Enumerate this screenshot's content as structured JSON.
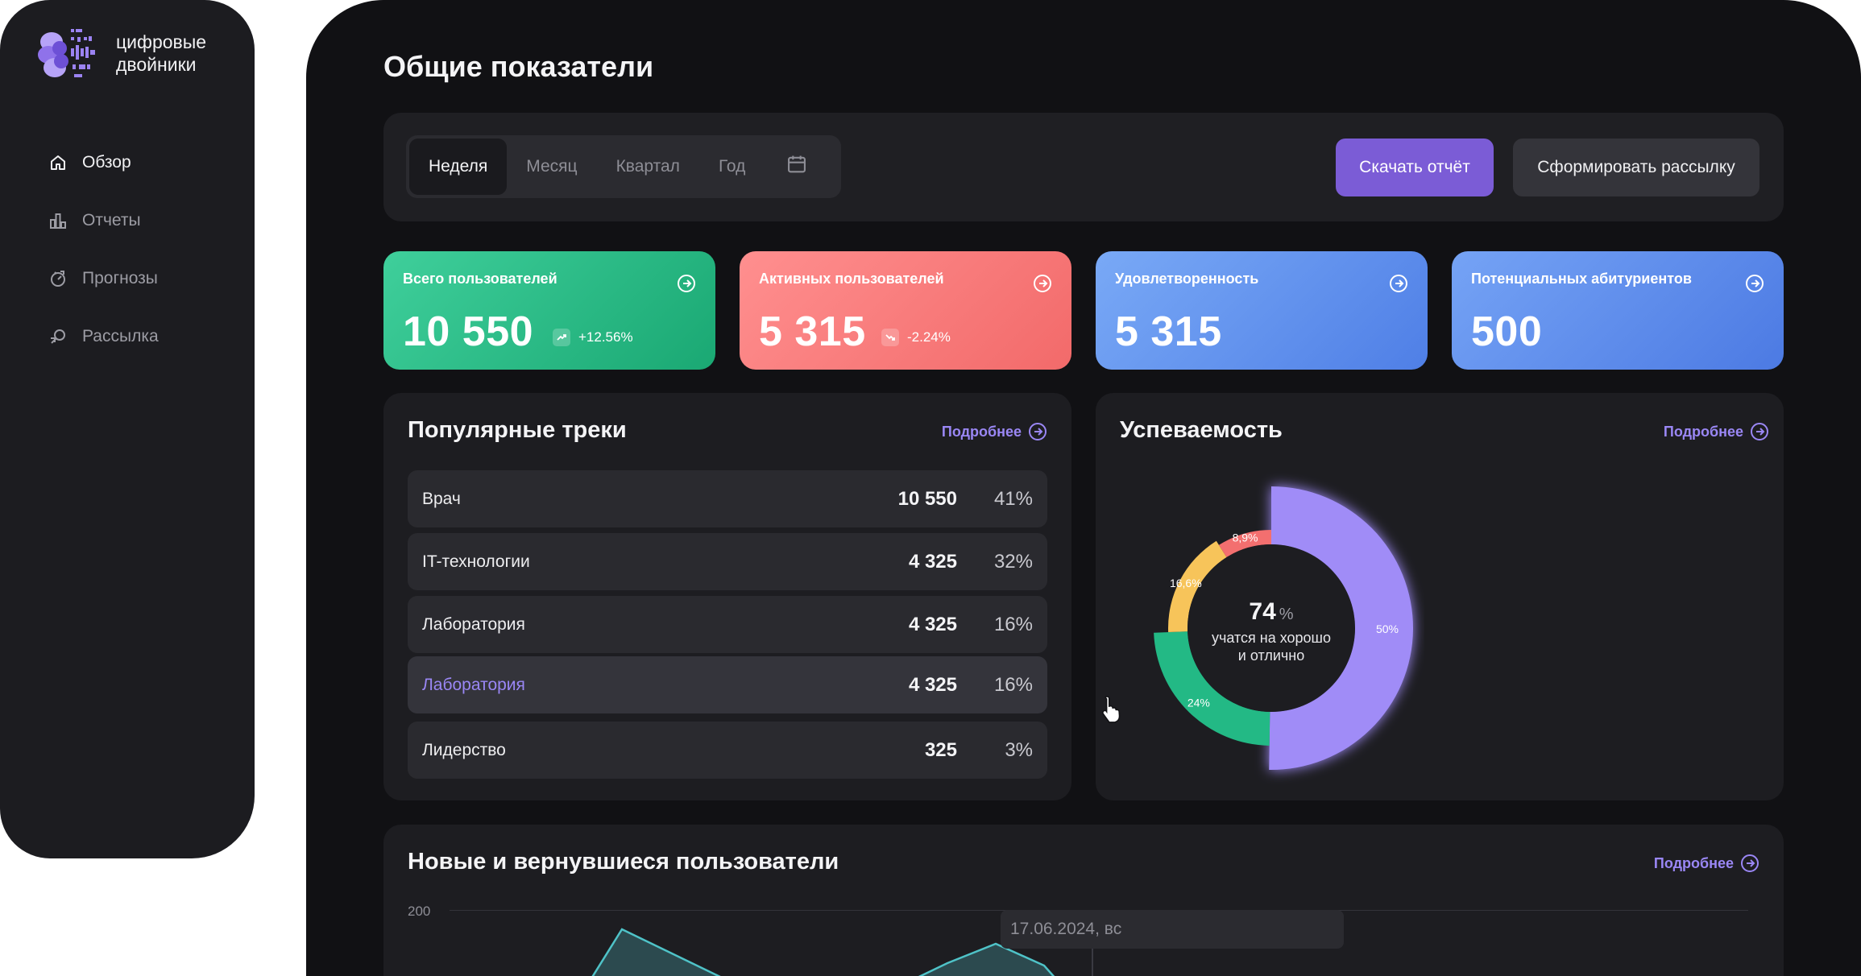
{
  "brand": {
    "line1": "цифровые",
    "line2": "двойники"
  },
  "sidebar": {
    "items": [
      {
        "label": "Обзор",
        "icon": "home-icon",
        "active": true
      },
      {
        "label": "Отчеты",
        "icon": "bar-chart-icon",
        "active": false
      },
      {
        "label": "Прогнозы",
        "icon": "forecast-icon",
        "active": false
      },
      {
        "label": "Рассылка",
        "icon": "mailing-icon",
        "active": false
      }
    ]
  },
  "page": {
    "title": "Общие показатели"
  },
  "toolbar": {
    "periods": [
      "Неделя",
      "Месяц",
      "Квартал",
      "Год"
    ],
    "active_period": "Неделя",
    "download_label": "Скачать отчёт",
    "mailing_label": "Сформировать рассылку"
  },
  "kpis": [
    {
      "label": "Всего пользователей",
      "value": "10 550",
      "delta": "+12.56%",
      "trend": "up",
      "color": "#1fb37c"
    },
    {
      "label": "Активных пользователей",
      "value": "5 315",
      "delta": "-2.24%",
      "trend": "down",
      "color": "#f47070"
    },
    {
      "label": "Удовлетворенность",
      "value": "5 315",
      "color": "#5586ea"
    },
    {
      "label": "Потенциальных абитуриентов",
      "value": "500",
      "color": "#5282e8"
    }
  ],
  "tracks": {
    "title": "Популярные треки",
    "more": "Подробнее",
    "rows": [
      {
        "name": "Врач",
        "count": "10 550",
        "pct": "41%"
      },
      {
        "name": "IT-технологии",
        "count": "4 325",
        "pct": "32%"
      },
      {
        "name": "Лаборатория",
        "count": "4 325",
        "pct": "16%"
      },
      {
        "name": "Лаборатория",
        "count": "4 325",
        "pct": "16%"
      },
      {
        "name": "Лидерство",
        "count": "325",
        "pct": "3%"
      }
    ]
  },
  "performance": {
    "title": "Успеваемость",
    "more": "Подробнее",
    "center_value": "74",
    "center_unit": "%",
    "center_line1": "учатся на хорошо",
    "center_line2": "и отлично",
    "slices": [
      {
        "label": "50%",
        "value": 50,
        "color": "#a08cf7"
      },
      {
        "label": "24%",
        "value": 24,
        "color": "#23b985"
      },
      {
        "label": "16,6%",
        "value": 16.6,
        "color": "#f7c45a"
      },
      {
        "label": "8,9%",
        "value": 8.9,
        "color": "#f36f6f"
      }
    ]
  },
  "new_users": {
    "title": "Новые и вернувшиеся пользователи",
    "more": "Подробнее",
    "y_tick": "200",
    "tooltip_date": "17.06.2024, вс"
  }
}
